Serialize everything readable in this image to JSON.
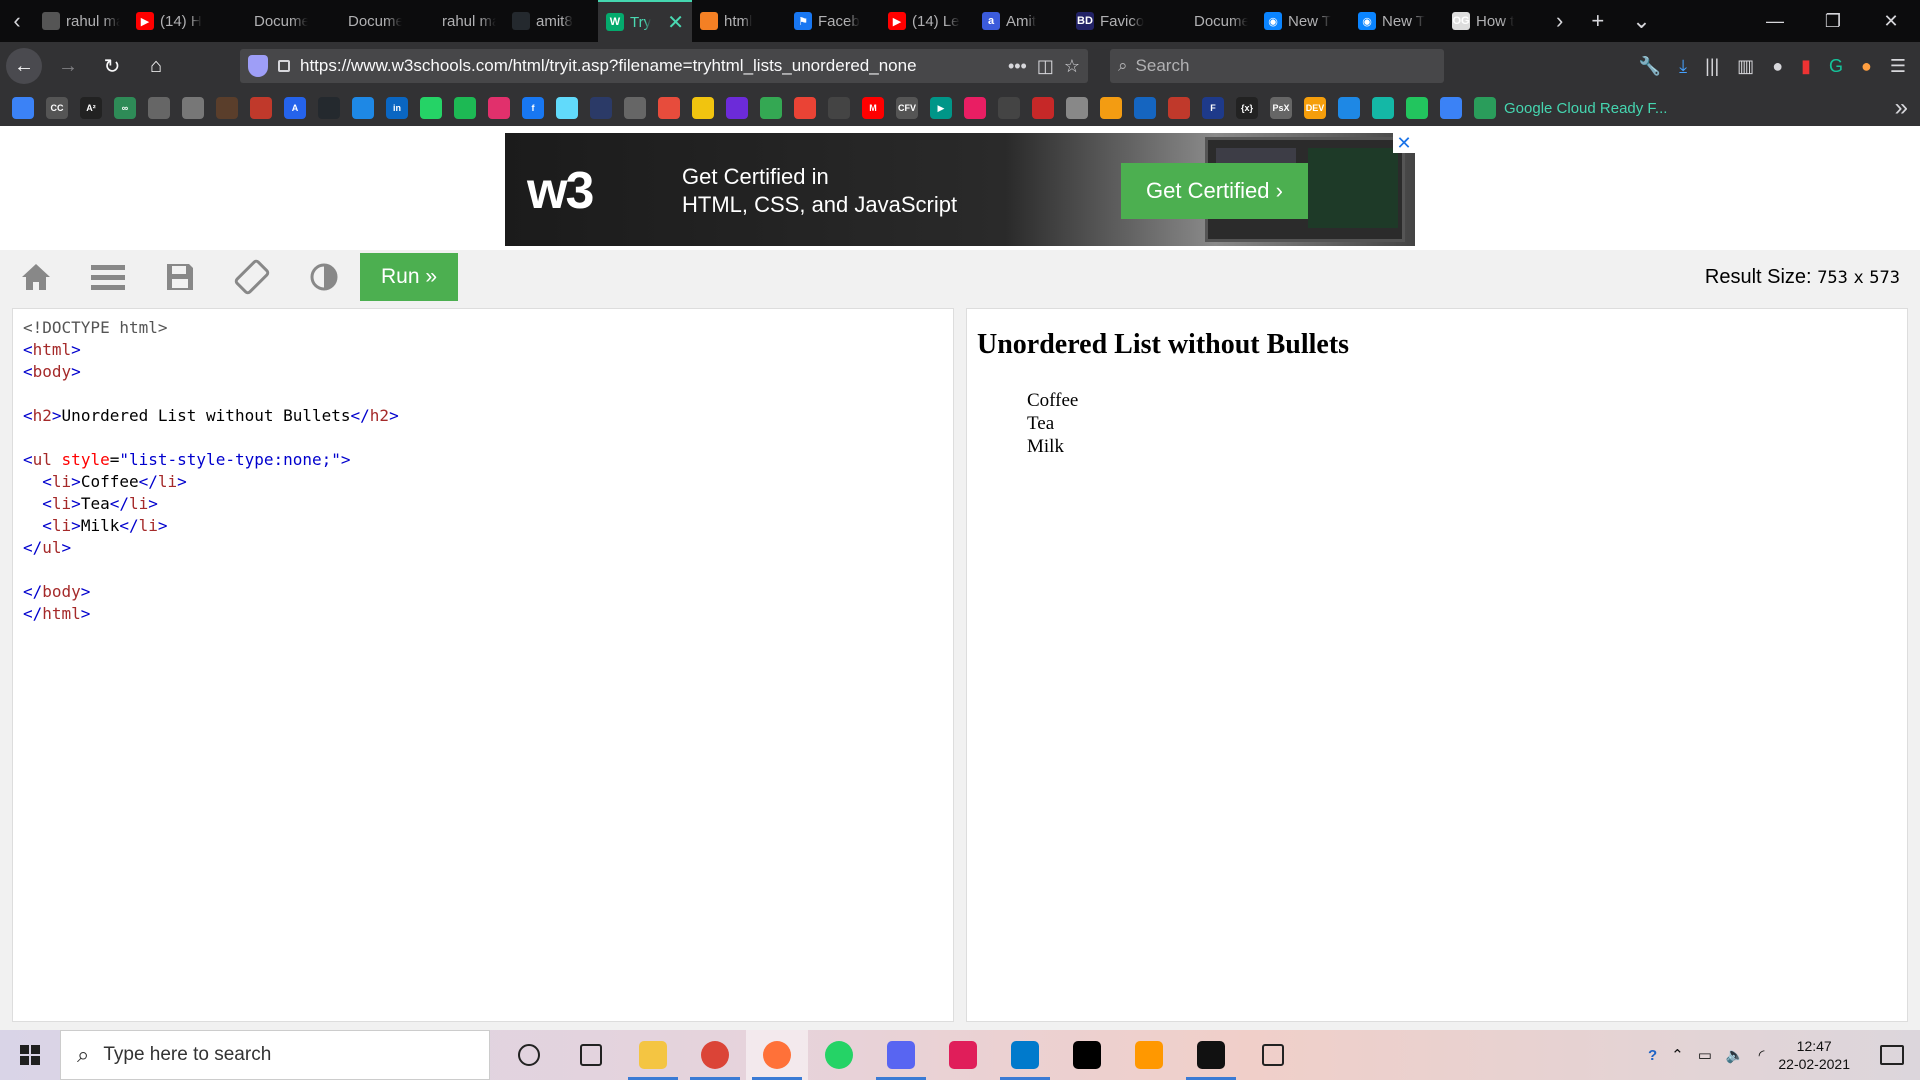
{
  "browser": {
    "tabs": [
      {
        "title": "rahul mah",
        "color": "#555555",
        "glyph": ""
      },
      {
        "title": "(14) H",
        "color": "#ff0000",
        "glyph": "▶"
      },
      {
        "title": "Document",
        "color": "",
        "glyph": ""
      },
      {
        "title": "Document",
        "color": "",
        "glyph": ""
      },
      {
        "title": "rahul mah",
        "color": "",
        "glyph": ""
      },
      {
        "title": "amit8",
        "color": "#24292e",
        "glyph": ""
      },
      {
        "title": "Try",
        "color": "#04aa6d",
        "glyph": "W",
        "active": true
      },
      {
        "title": "html",
        "color": "#f48024",
        "glyph": ""
      },
      {
        "title": "Faceb",
        "color": "#1877f2",
        "glyph": "⚑"
      },
      {
        "title": "(14) Le",
        "color": "#ff0000",
        "glyph": "▶"
      },
      {
        "title": "Amit",
        "color": "#3b5bdb",
        "glyph": "a"
      },
      {
        "title": "Favico",
        "color": "#222266",
        "glyph": "BD"
      },
      {
        "title": "Document",
        "color": "",
        "glyph": ""
      },
      {
        "title": "New T",
        "color": "#0a84ff",
        "glyph": "◉"
      },
      {
        "title": "New T",
        "color": "#0a84ff",
        "glyph": "◉"
      },
      {
        "title": "How t",
        "color": "#dddddd",
        "glyph": "OG"
      }
    ],
    "url": "https://www.w3schools.com/html/tryit.asp?filename=tryhtml_lists_unordered_none",
    "search_placeholder": "Search",
    "bookmark_colors": [
      "#3b82f6",
      "#555",
      "#222",
      "#2e8b57",
      "#666",
      "#777",
      "#5a3e2b",
      "#c0392b",
      "#2563eb",
      "#24292e",
      "#1e88e5",
      "#0a66c2",
      "#25d366",
      "#1db954",
      "#e1306c",
      "#1877f2",
      "#61dafb",
      "#2b3a67",
      "#666",
      "#e74c3c",
      "#f1c40f",
      "#6c2bd9",
      "#34a853",
      "#ea4335",
      "#444",
      "#ff0000",
      "#555",
      "#009688",
      "#e91e63",
      "#444",
      "#c62828",
      "#888",
      "#f39c12",
      "#1565c0",
      "#c0392b",
      "#1e3a8a",
      "#222",
      "#666",
      "#f59e0b",
      "#1e88e5",
      "#14b8a6",
      "#22c55e",
      "#3b82f6"
    ],
    "bookmark_glyphs": [
      "",
      "CC",
      "A²",
      "∞",
      "",
      "",
      "",
      "",
      "A",
      "",
      "",
      "in",
      "",
      "",
      "",
      "f",
      "",
      "",
      "",
      "",
      "",
      "",
      "",
      "",
      "",
      "M",
      "CFV",
      "▶",
      "",
      "",
      "",
      "",
      "",
      "",
      "",
      "F",
      "{x}",
      "PsX",
      "DEV",
      "",
      "",
      "",
      ""
    ],
    "bookmark_folder": "Google Cloud Ready F..."
  },
  "ad": {
    "logo": "w3",
    "line1": "Get Certified in",
    "line2": "HTML, CSS, and JavaScript",
    "cta": "Get Certified ›",
    "close": "✕"
  },
  "toolbar": {
    "run_label": "Run »",
    "result_label": "Result Size:",
    "result_width": "753",
    "result_x": "x",
    "result_height": "573"
  },
  "code": {
    "lines": [
      [
        {
          "t": "doc",
          "v": "<!DOCTYPE html>"
        }
      ],
      [
        {
          "t": "br",
          "v": "<"
        },
        {
          "t": "tag",
          "v": "html"
        },
        {
          "t": "br",
          "v": ">"
        }
      ],
      [
        {
          "t": "br",
          "v": "<"
        },
        {
          "t": "tag",
          "v": "body"
        },
        {
          "t": "br",
          "v": ">"
        }
      ],
      [],
      [
        {
          "t": "br",
          "v": "<"
        },
        {
          "t": "tag",
          "v": "h2"
        },
        {
          "t": "br",
          "v": ">"
        },
        {
          "t": "txt",
          "v": "Unordered List without Bullets"
        },
        {
          "t": "br",
          "v": "</"
        },
        {
          "t": "tag",
          "v": "h2"
        },
        {
          "t": "br",
          "v": ">"
        }
      ],
      [],
      [
        {
          "t": "br",
          "v": "<"
        },
        {
          "t": "tag",
          "v": "ul"
        },
        {
          "t": "txt",
          "v": " "
        },
        {
          "t": "attr",
          "v": "style"
        },
        {
          "t": "txt",
          "v": "="
        },
        {
          "t": "val",
          "v": "\"list-style-type:none;\""
        },
        {
          "t": "br",
          "v": ">"
        }
      ],
      [
        {
          "t": "txt",
          "v": "  "
        },
        {
          "t": "br",
          "v": "<"
        },
        {
          "t": "tag",
          "v": "li"
        },
        {
          "t": "br",
          "v": ">"
        },
        {
          "t": "txt",
          "v": "Coffee"
        },
        {
          "t": "br",
          "v": "</"
        },
        {
          "t": "tag",
          "v": "li"
        },
        {
          "t": "br",
          "v": ">"
        }
      ],
      [
        {
          "t": "txt",
          "v": "  "
        },
        {
          "t": "br",
          "v": "<"
        },
        {
          "t": "tag",
          "v": "li"
        },
        {
          "t": "br",
          "v": ">"
        },
        {
          "t": "txt",
          "v": "Tea"
        },
        {
          "t": "br",
          "v": "</"
        },
        {
          "t": "tag",
          "v": "li"
        },
        {
          "t": "br",
          "v": ">"
        }
      ],
      [
        {
          "t": "txt",
          "v": "  "
        },
        {
          "t": "br",
          "v": "<"
        },
        {
          "t": "tag",
          "v": "li"
        },
        {
          "t": "br",
          "v": ">"
        },
        {
          "t": "txt",
          "v": "Milk"
        },
        {
          "t": "br",
          "v": "</"
        },
        {
          "t": "tag",
          "v": "li"
        },
        {
          "t": "br",
          "v": ">"
        }
      ],
      [
        {
          "t": "br",
          "v": "</"
        },
        {
          "t": "tag",
          "v": "ul"
        },
        {
          "t": "br",
          "v": ">"
        }
      ],
      [],
      [
        {
          "t": "br",
          "v": "</"
        },
        {
          "t": "tag",
          "v": "body"
        },
        {
          "t": "br",
          "v": ">"
        }
      ],
      [
        {
          "t": "br",
          "v": "</"
        },
        {
          "t": "tag",
          "v": "html"
        },
        {
          "t": "br",
          "v": ">"
        }
      ]
    ]
  },
  "result": {
    "heading": "Unordered List without Bullets",
    "items": [
      "Coffee",
      "Tea",
      "Milk"
    ]
  },
  "taskbar": {
    "search_placeholder": "Type here to search",
    "apps": [
      {
        "name": "cortana-icon",
        "color": "transparent"
      },
      {
        "name": "task-view-icon",
        "color": "transparent"
      },
      {
        "name": "file-explorer-icon",
        "color": "#f4c542",
        "running": true
      },
      {
        "name": "chrome-icon",
        "color": "#db4437",
        "running": true
      },
      {
        "name": "firefox-icon",
        "color": "#ff7139",
        "running": true,
        "active": true
      },
      {
        "name": "whatsapp-icon",
        "color": "#25d366"
      },
      {
        "name": "discord-icon",
        "color": "#5865f2",
        "running": true
      },
      {
        "name": "slack-icon",
        "color": "#e01e5a"
      },
      {
        "name": "vscode-icon",
        "color": "#007acc",
        "running": true
      },
      {
        "name": "intellij-icon",
        "color": "#000000"
      },
      {
        "name": "sublime-icon",
        "color": "#ff9800"
      },
      {
        "name": "terminal-icon",
        "color": "#111111",
        "running": true
      },
      {
        "name": "feedback-icon",
        "color": "transparent"
      }
    ],
    "time": "12:47",
    "date": "22-02-2021"
  }
}
